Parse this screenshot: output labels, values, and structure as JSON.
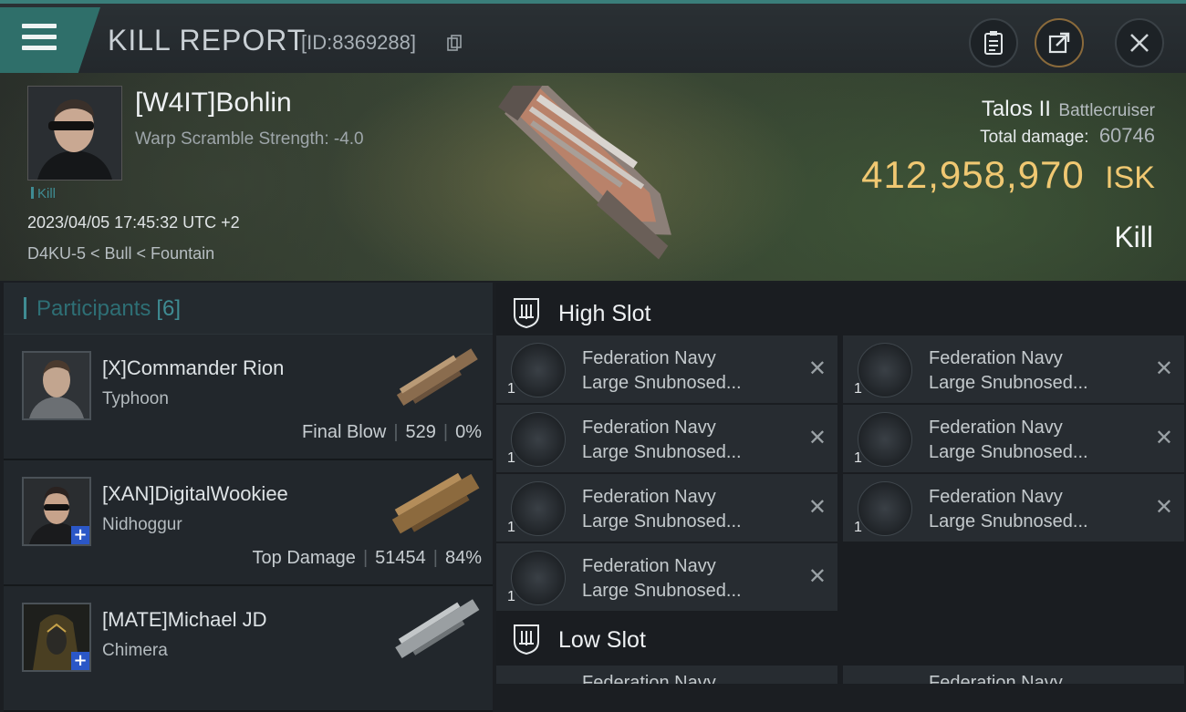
{
  "header": {
    "title": "KILL REPORT",
    "report_id": "[ID:8369288]"
  },
  "victim": {
    "name": "[W4IT]Bohlin",
    "warp_scramble": "Warp Scramble Strength: -4.0",
    "kill_tag": "Kill",
    "datetime": "2023/04/05 17:45:32 UTC +2",
    "location": "D4KU-5 < Bull < Fountain",
    "ship_name": "Talos II",
    "ship_class": "Battlecruiser",
    "total_damage_label": "Total damage:",
    "total_damage": "60746",
    "isk_value": "412,958,970",
    "isk_unit": "ISK",
    "outcome": "Kill"
  },
  "participants": {
    "label": "Participants",
    "count": "[6]",
    "items": [
      {
        "name": "[X]Commander Rion",
        "ship": "Typhoon",
        "role": "Final Blow",
        "damage": "529",
        "percent": "0%",
        "plus": false
      },
      {
        "name": "[XAN]DigitalWookiee",
        "ship": "Nidhoggur",
        "role": "Top Damage",
        "damage": "51454",
        "percent": "84%",
        "plus": true
      },
      {
        "name": "[MATE]Michael JD",
        "ship": "Chimera",
        "role": "",
        "damage": "",
        "percent": "",
        "plus": true
      }
    ]
  },
  "fitting": {
    "high_slot_label": "High Slot",
    "low_slot_label": "Low Slot",
    "high_modules": [
      {
        "line1": "Federation Navy",
        "line2": "Large Snubnosed...",
        "qty": "1"
      },
      {
        "line1": "Federation Navy",
        "line2": "Large Snubnosed...",
        "qty": "1"
      },
      {
        "line1": "Federation Navy",
        "line2": "Large Snubnosed...",
        "qty": "1"
      },
      {
        "line1": "Federation Navy",
        "line2": "Large Snubnosed...",
        "qty": "1"
      },
      {
        "line1": "Federation Navy",
        "line2": "Large Snubnosed...",
        "qty": "1"
      },
      {
        "line1": "Federation Navy",
        "line2": "Large Snubnosed...",
        "qty": "1"
      },
      {
        "line1": "Federation Navy",
        "line2": "Large Snubnosed...",
        "qty": "1"
      }
    ],
    "low_modules": [
      {
        "line1": "Federation Navy"
      },
      {
        "line1": "Federation Navy"
      }
    ]
  },
  "icons": {
    "menu": "hamburger-menu-icon",
    "copy": "copy-icon",
    "clipboard": "clipboard-icon",
    "share": "share-icon",
    "close": "close-icon",
    "slot": "shield-slot-icon",
    "remove": "x-icon"
  },
  "colors": {
    "accent_teal": "#3f8c93",
    "isk_gold": "#f0c872",
    "menu_tab": "#2f6f6a"
  }
}
